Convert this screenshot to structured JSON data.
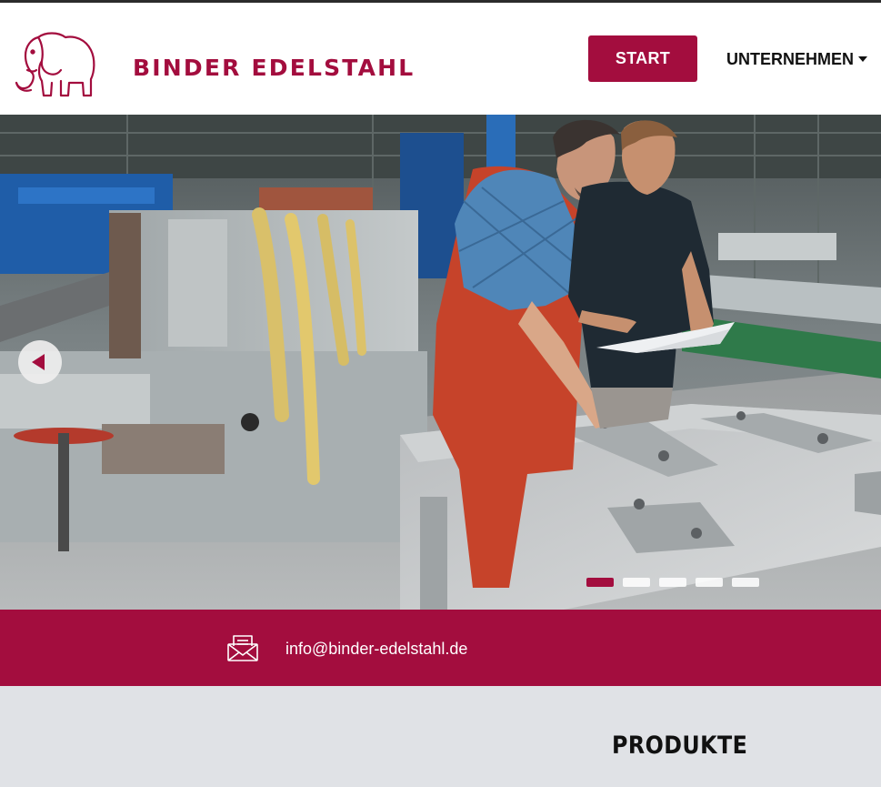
{
  "header": {
    "brand_name": "BINDER EDELSTAHL",
    "nav": {
      "start_label": "START",
      "unternehmen_label": "UNTERNEHMEN"
    }
  },
  "hero": {
    "prev_icon": "chevron-left-icon",
    "active_slide_index": 0,
    "slide_count": 5
  },
  "contact": {
    "email": "info@binder-edelstahl.de",
    "icon": "envelope-icon"
  },
  "section": {
    "title": "PRODUKTE"
  },
  "colors": {
    "brand": "#a30d3e",
    "lower_background": "#e0e2e6",
    "header_background": "#ffffff"
  }
}
